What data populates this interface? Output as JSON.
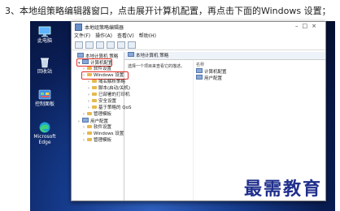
{
  "caption": "3、本地组策略编辑器窗口，点击展开计算机配置，再点击下面的Windows 设置；",
  "desktop_icons": [
    {
      "label": "此电脑",
      "icon": "monitor-icon"
    },
    {
      "label": "回收站",
      "icon": "recycle-bin-icon"
    },
    {
      "label": "控制面板",
      "icon": "control-panel-icon"
    },
    {
      "label": "Microsoft Edge",
      "icon": "edge-icon"
    }
  ],
  "window": {
    "title": "本地组策略编辑器",
    "menu": [
      "文件(F)",
      "操作(A)",
      "查看(V)",
      "帮助(H)"
    ],
    "tree": [
      {
        "label": "本地计算机 策略",
        "level": 0,
        "type": "pc"
      },
      {
        "label": "计算机配置",
        "level": 1,
        "type": "pc",
        "expanded": true,
        "highlight": true
      },
      {
        "label": "软件设置",
        "level": 2,
        "type": "folder"
      },
      {
        "label": "Windows 设置",
        "level": 2,
        "type": "folder",
        "highlight": true
      },
      {
        "label": "域名解析策略",
        "level": 3,
        "type": "folder"
      },
      {
        "label": "脚本(启动/关机)",
        "level": 3,
        "type": "folder"
      },
      {
        "label": "已部署的打印机",
        "level": 3,
        "type": "folder"
      },
      {
        "label": "安全设置",
        "level": 3,
        "type": "folder"
      },
      {
        "label": "基于策略的 QoS",
        "level": 3,
        "type": "folder"
      },
      {
        "label": "管理模板",
        "level": 2,
        "type": "folder"
      },
      {
        "label": "用户配置",
        "level": 1,
        "type": "pc"
      },
      {
        "label": "软件设置",
        "level": 2,
        "type": "folder"
      },
      {
        "label": "Windows 设置",
        "level": 2,
        "type": "folder"
      },
      {
        "label": "管理模板",
        "level": 2,
        "type": "folder"
      }
    ],
    "right_tab": "本地计算机 策略",
    "description": "选择一个项目来查看它的描述。",
    "column_header": "名称",
    "right_items": [
      "计算机配置",
      "用户配置"
    ]
  },
  "watermark": "最需教育"
}
